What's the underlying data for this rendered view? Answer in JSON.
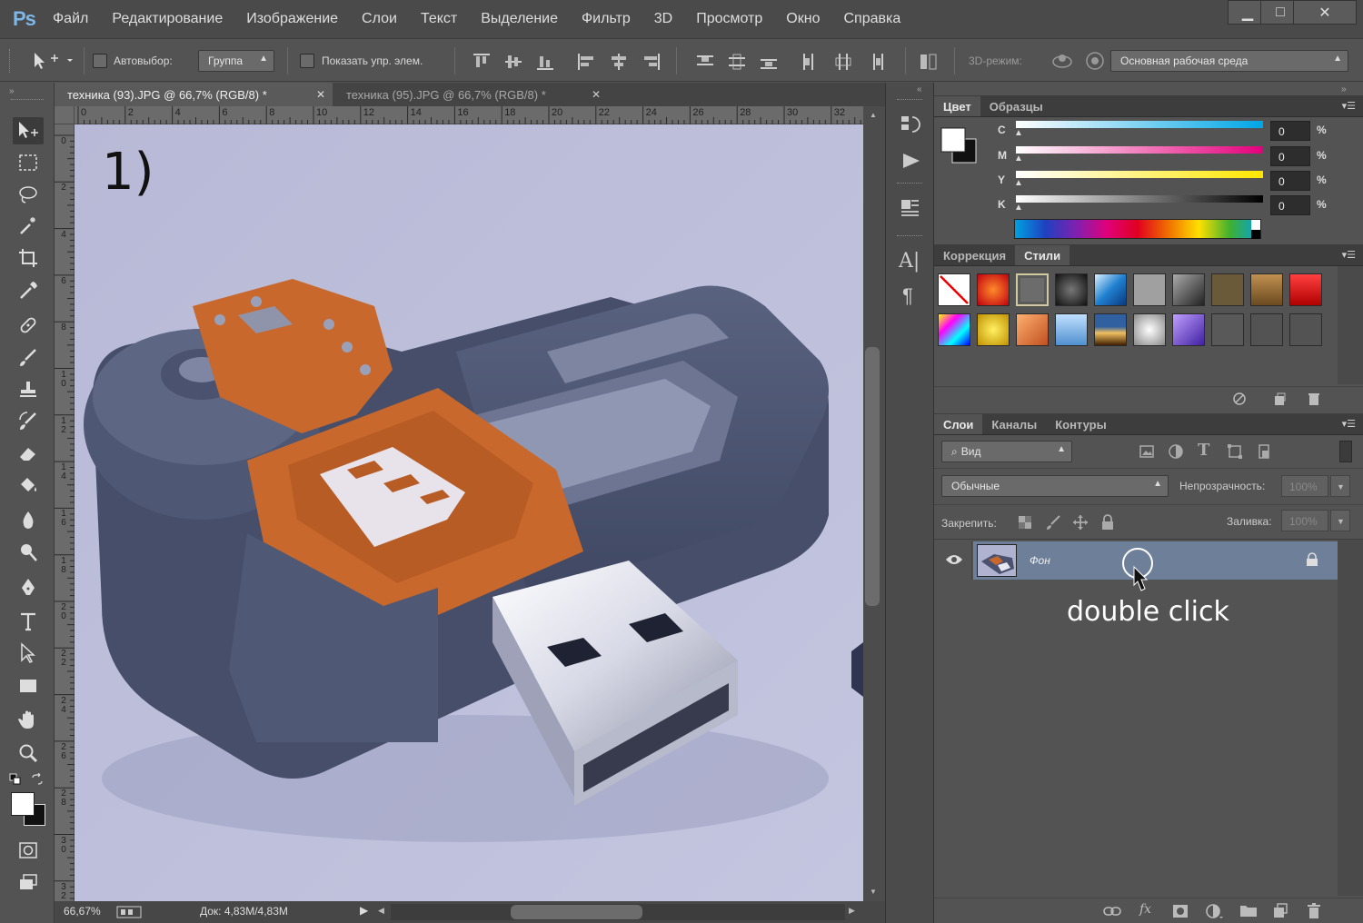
{
  "app": {
    "logo": "Ps"
  },
  "menu": [
    "Файл",
    "Редактирование",
    "Изображение",
    "Слои",
    "Текст",
    "Выделение",
    "Фильтр",
    "3D",
    "Просмотр",
    "Окно",
    "Справка"
  ],
  "window": {
    "minimize": "▁",
    "maximize": "□",
    "close": "✕"
  },
  "options": {
    "autoselect_label": "Автовыбор:",
    "group_value": "Группа",
    "show_transform_label": "Показать упр. элем.",
    "mode3d_label": "3D-режим:",
    "workspace_value": "Основная рабочая среда"
  },
  "tabs": [
    {
      "title": "техника (93).JPG @ 66,7% (RGB/8) *",
      "active": true
    },
    {
      "title": "техника (95).JPG @ 66,7% (RGB/8) *",
      "active": false
    }
  ],
  "ruler_h": [
    "0",
    "2",
    "4",
    "6",
    "8",
    "10",
    "12",
    "14",
    "16",
    "18",
    "20",
    "22",
    "24",
    "26",
    "28",
    "30",
    "32"
  ],
  "ruler_v": [
    "0",
    "2",
    "4",
    "6",
    "8",
    "10",
    "12",
    "14",
    "16",
    "18",
    "20",
    "22",
    "24",
    "26",
    "28",
    "30",
    "32"
  ],
  "canvas": {
    "step_label": "1)"
  },
  "status": {
    "zoom": "66,67%",
    "doc": "Док: 4,83M/4,83M"
  },
  "color_panel": {
    "tabs": [
      "Цвет",
      "Образцы"
    ],
    "channels": [
      {
        "label": "C",
        "value": "0",
        "unit": "%"
      },
      {
        "label": "M",
        "value": "0",
        "unit": "%"
      },
      {
        "label": "Y",
        "value": "0",
        "unit": "%"
      },
      {
        "label": "K",
        "value": "0",
        "unit": "%"
      }
    ]
  },
  "styles_panel": {
    "tabs": [
      "Коррекция",
      "Стили"
    ]
  },
  "layers_panel": {
    "tabs": [
      "Слои",
      "Каналы",
      "Контуры"
    ],
    "filter_placeholder": "Вид",
    "blend_mode": "Обычные",
    "opacity_label": "Непрозрачность:",
    "opacity_value": "100%",
    "lock_label": "Закрепить:",
    "fill_label": "Заливка:",
    "fill_value": "100%",
    "layers": [
      {
        "name": "Фон",
        "visible": true,
        "locked": true
      }
    ]
  },
  "annotation": {
    "text": "double click"
  },
  "colors": {
    "accent_logo": "#7db6e8",
    "layer_selected": "#6e8099",
    "orange": "#c8682c"
  }
}
